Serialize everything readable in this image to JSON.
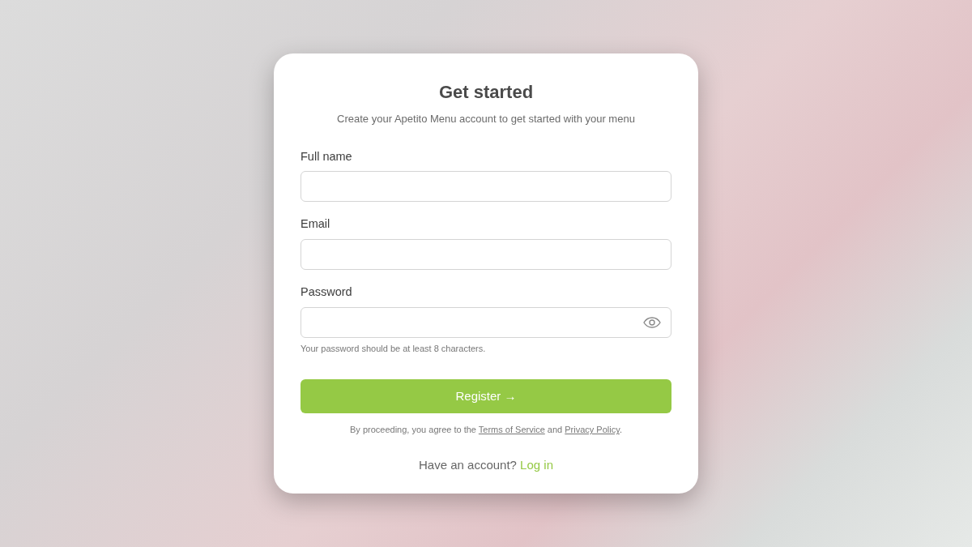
{
  "title": "Get started",
  "subtitle": "Create your Apetito Menu account to get started with your menu",
  "fields": [
    {
      "label": "Full name",
      "kind": "text"
    },
    {
      "label": "Email",
      "kind": "email"
    },
    {
      "label": "Password",
      "kind": "password",
      "hint": "Your password should be at least 8 characters."
    }
  ],
  "submit": "Register →",
  "terms": {
    "before": "By proceeding, you agree to the",
    "link_1": "Terms of Service",
    "middle": "and",
    "link_2": "Privacy Policy",
    "after": "."
  },
  "footer": {
    "text": "Have an account?",
    "link": "Log in"
  }
}
